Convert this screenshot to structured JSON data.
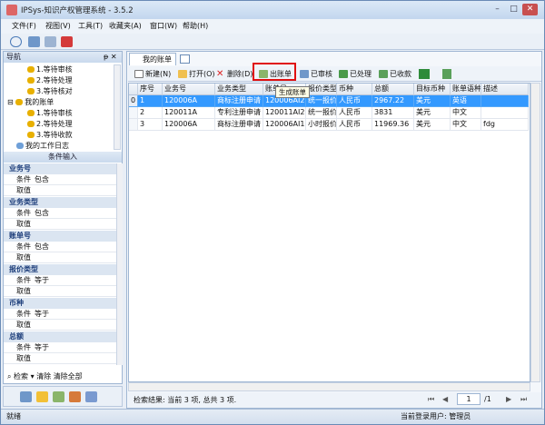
{
  "title": "IPSys-知识产权管理系统 - 3.5.2",
  "menu": [
    "文件(F)",
    "视图(V)",
    "工具(T)",
    "收藏夹(A)",
    "窗口(W)",
    "帮助(H)"
  ],
  "nav": {
    "header": "导航",
    "pin": "ᵽ ✕",
    "tree": [
      "1.等待审核",
      "2.等待处理",
      "3.等待核对",
      "我的账单",
      "1.等待审核",
      "2.等待处理",
      "3.等待收款",
      "我的工作日志"
    ],
    "cond_header": "条件输入",
    "groups": [
      {
        "title": "业务号",
        "rows": [
          [
            "条件",
            "包含"
          ],
          [
            "取值",
            ""
          ]
        ]
      },
      {
        "title": "业务类型",
        "rows": [
          [
            "条件",
            "包含"
          ],
          [
            "取值",
            ""
          ]
        ]
      },
      {
        "title": "账单号",
        "rows": [
          [
            "条件",
            "包含"
          ],
          [
            "取值",
            ""
          ]
        ]
      },
      {
        "title": "报价类型",
        "rows": [
          [
            "条件",
            "等于"
          ],
          [
            "取值",
            ""
          ]
        ]
      },
      {
        "title": "币种",
        "rows": [
          [
            "条件",
            "等于"
          ],
          [
            "取值",
            ""
          ]
        ]
      },
      {
        "title": "总额",
        "rows": [
          [
            "条件",
            "等于"
          ],
          [
            "取值",
            ""
          ]
        ]
      }
    ],
    "search": "检索",
    "clear": "清除",
    "clear_all": "清除全部"
  },
  "tab": "我的账单",
  "toolbar": [
    "新建(N)",
    "打开(O)",
    "删除(D)",
    "出账单",
    "已审核",
    "已处理",
    "已收款"
  ],
  "tooltip": "生成账单",
  "grid": {
    "headers": [
      "",
      "序号",
      "业务号",
      "业务类型",
      "账单号",
      "报价类型",
      "币种",
      "总额",
      "目标币种",
      "账单语种",
      "描述"
    ],
    "rows": [
      [
        "0",
        "1",
        "120006A",
        "商标注册申请",
        "120006AI2",
        "统一报价",
        "人民币",
        "2967.22",
        "美元",
        "英语",
        ""
      ],
      [
        "",
        "2",
        "120011A",
        "专利注册申请",
        "120011AI2",
        "统一报价",
        "人民币",
        "3831",
        "美元",
        "中文",
        ""
      ],
      [
        "",
        "3",
        "120006A",
        "商标注册申请",
        "120006AI1.1",
        "小时报价",
        "人民币",
        "11969.36",
        "美元",
        "中文",
        "fdg"
      ]
    ]
  },
  "result": "检索结果: 当前 3 项, 总共 3 项.",
  "page": "1",
  "page_total": "/1",
  "status_left": "就绪",
  "status_right": "当前登录用户: 管理员"
}
